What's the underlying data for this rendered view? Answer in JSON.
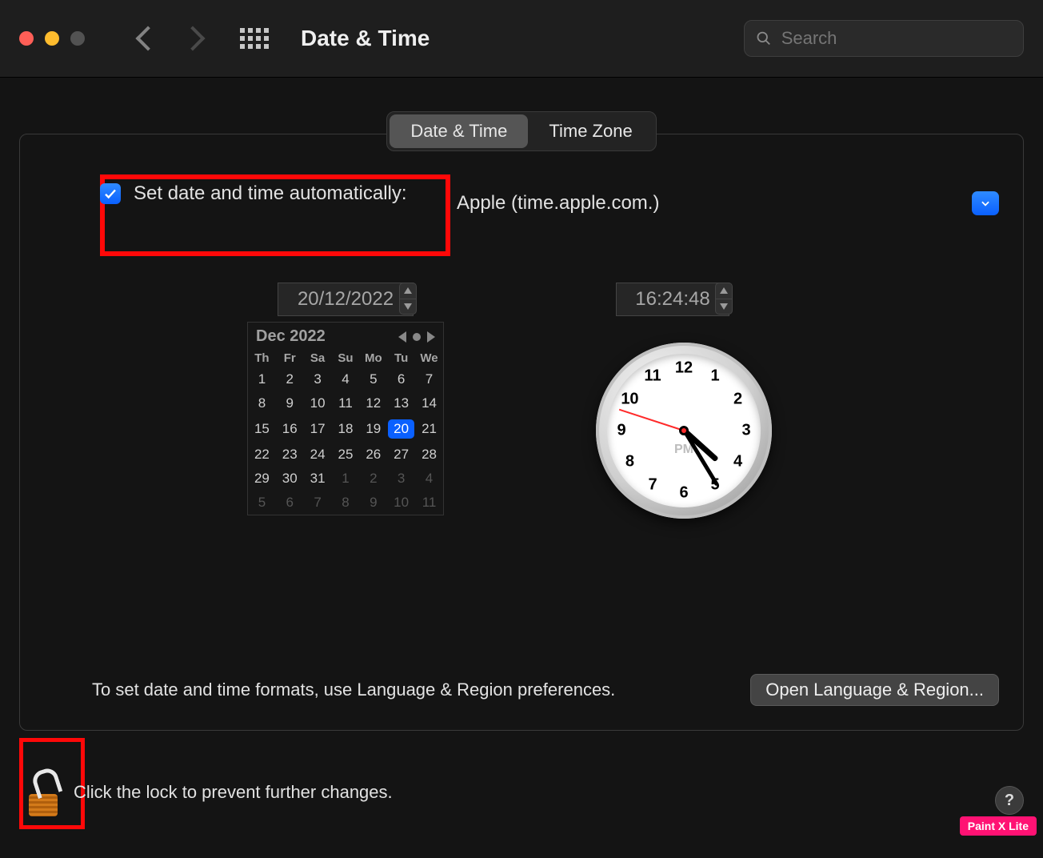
{
  "window": {
    "title": "Date & Time"
  },
  "search": {
    "placeholder": "Search"
  },
  "tabs": {
    "date_time": "Date & Time",
    "time_zone": "Time Zone",
    "selected": "date_time"
  },
  "auto": {
    "label": "Set date and time automatically:",
    "checked": true,
    "server": "Apple (time.apple.com.)"
  },
  "date_field": "20/12/2022",
  "time_field": "16:24:48",
  "calendar": {
    "month_label": "Dec 2022",
    "weekdays": [
      "Th",
      "Fr",
      "Sa",
      "Su",
      "Mo",
      "Tu",
      "We"
    ],
    "rows": [
      [
        {
          "d": "1"
        },
        {
          "d": "2"
        },
        {
          "d": "3"
        },
        {
          "d": "4"
        },
        {
          "d": "5"
        },
        {
          "d": "6"
        },
        {
          "d": "7"
        }
      ],
      [
        {
          "d": "8"
        },
        {
          "d": "9"
        },
        {
          "d": "10"
        },
        {
          "d": "11"
        },
        {
          "d": "12"
        },
        {
          "d": "13"
        },
        {
          "d": "14"
        }
      ],
      [
        {
          "d": "15"
        },
        {
          "d": "16"
        },
        {
          "d": "17"
        },
        {
          "d": "18"
        },
        {
          "d": "19"
        },
        {
          "d": "20",
          "sel": true
        },
        {
          "d": "21"
        }
      ],
      [
        {
          "d": "22"
        },
        {
          "d": "23"
        },
        {
          "d": "24"
        },
        {
          "d": "25"
        },
        {
          "d": "26"
        },
        {
          "d": "27"
        },
        {
          "d": "28"
        }
      ],
      [
        {
          "d": "29"
        },
        {
          "d": "30"
        },
        {
          "d": "31"
        },
        {
          "d": "1",
          "dim": true
        },
        {
          "d": "2",
          "dim": true
        },
        {
          "d": "3",
          "dim": true
        },
        {
          "d": "4",
          "dim": true
        }
      ],
      [
        {
          "d": "5",
          "dim": true
        },
        {
          "d": "6",
          "dim": true
        },
        {
          "d": "7",
          "dim": true
        },
        {
          "d": "8",
          "dim": true
        },
        {
          "d": "9",
          "dim": true
        },
        {
          "d": "10",
          "dim": true
        },
        {
          "d": "11",
          "dim": true
        }
      ]
    ]
  },
  "clock": {
    "hours": 16,
    "minutes": 24,
    "seconds": 48,
    "ampm": "PM",
    "numbers": [
      "12",
      "1",
      "2",
      "3",
      "4",
      "5",
      "6",
      "7",
      "8",
      "9",
      "10",
      "11"
    ]
  },
  "footer": {
    "hint": "To set date and time formats, use Language & Region preferences.",
    "button": "Open Language & Region..."
  },
  "lock": {
    "text": "Click the lock to prevent further changes."
  },
  "watermark": "Paint X Lite"
}
